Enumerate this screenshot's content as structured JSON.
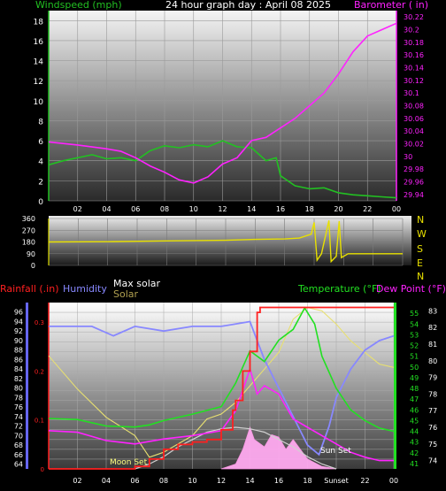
{
  "colors": {
    "wind": "#22c022",
    "baro": "#ff22ff",
    "dir": "#e8e000",
    "rain": "#ff2020",
    "humidity": "#8888ff",
    "maxsolar": "#d0d0d0",
    "solar": "#e8e070",
    "temp": "#22e022",
    "dew": "#ff22ff",
    "solarfill": "#ffaaf0"
  },
  "header": {
    "wind_label": "Windspeed (mph)",
    "title": "24 hour graph day : April 08 2025",
    "baro_label": "Barometer ( in)"
  },
  "mid": {
    "compass": [
      "N",
      "W",
      "S",
      "E",
      "N"
    ]
  },
  "lower": {
    "rain_label": "Rainfall (.in)",
    "humidity_label": "Humidity",
    "maxsolar_label": "Max solar",
    "solar_label": "Solar",
    "temp_label": "Temperature (°F)",
    "dew_label": "Dew Point (°F)",
    "moonset_label": "Moon Set",
    "sunset_label": "Sun Set",
    "sunset_tick_label": "Sunset"
  },
  "chart_data": [
    {
      "type": "line",
      "title": "24 hour graph day : April 08 2025",
      "x_ticks": [
        "02",
        "04",
        "06",
        "08",
        "10",
        "12",
        "14",
        "16",
        "18",
        "20",
        "22",
        "00"
      ],
      "x_range_hours": [
        0,
        24
      ],
      "left_axis": {
        "label": "Windspeed (mph)",
        "ylim": [
          0,
          19
        ],
        "ticks": [
          "0",
          "2",
          "4",
          "6",
          "8",
          "10",
          "12",
          "14",
          "16",
          "18"
        ]
      },
      "right_axis": {
        "label": "Barometer ( in)",
        "ylim": [
          29.93,
          30.23
        ],
        "ticks": [
          "29.94",
          "29.96",
          "29.98",
          "30",
          "30.02",
          "30.04",
          "30.06",
          "30.08",
          "30.1",
          "30.12",
          "30.14",
          "30.16",
          "30.18",
          "30.2",
          "30.22"
        ]
      },
      "series": [
        {
          "name": "Windspeed (mph)",
          "axis": "left",
          "points": [
            [
              0,
              3.6
            ],
            [
              1,
              4.0
            ],
            [
              2,
              4.3
            ],
            [
              3,
              4.6
            ],
            [
              4,
              4.2
            ],
            [
              5,
              4.3
            ],
            [
              6,
              4.0
            ],
            [
              7,
              5.0
            ],
            [
              8,
              5.5
            ],
            [
              9,
              5.3
            ],
            [
              10,
              5.6
            ],
            [
              11,
              5.4
            ],
            [
              12,
              6.0
            ],
            [
              13,
              5.4
            ],
            [
              14,
              5.3
            ],
            [
              15,
              4.0
            ],
            [
              15.7,
              4.3
            ],
            [
              16,
              2.5
            ],
            [
              17,
              1.5
            ],
            [
              18,
              1.2
            ],
            [
              19,
              1.3
            ],
            [
              20,
              0.8
            ],
            [
              21,
              0.6
            ],
            [
              22,
              0.5
            ],
            [
              23,
              0.4
            ],
            [
              24,
              0.3
            ]
          ]
        },
        {
          "name": "Barometer ( in)",
          "axis": "right",
          "points": [
            [
              0,
              30.023
            ],
            [
              2,
              30.018
            ],
            [
              4,
              30.012
            ],
            [
              5,
              30.008
            ],
            [
              6,
              29.998
            ],
            [
              7,
              29.985
            ],
            [
              8,
              29.975
            ],
            [
              9,
              29.963
            ],
            [
              10,
              29.958
            ],
            [
              11,
              29.968
            ],
            [
              12,
              29.988
            ],
            [
              13,
              29.998
            ],
            [
              14,
              30.025
            ],
            [
              15,
              30.03
            ],
            [
              16,
              30.045
            ],
            [
              17,
              30.06
            ],
            [
              18,
              30.08
            ],
            [
              19,
              30.1
            ],
            [
              20,
              30.13
            ],
            [
              21,
              30.165
            ],
            [
              22,
              30.19
            ],
            [
              23,
              30.2
            ],
            [
              24,
              30.21
            ]
          ]
        }
      ]
    },
    {
      "type": "line",
      "title": "",
      "x_ticks": [
        "02",
        "04",
        "06",
        "08",
        "10",
        "12",
        "14",
        "16",
        "18",
        "20",
        "22",
        "00"
      ],
      "x_range_hours": [
        0,
        24
      ],
      "ylim": [
        0,
        360
      ],
      "y_ticks": [
        "0",
        "90",
        "180",
        "270",
        "360"
      ],
      "right_labels": [
        "N",
        "W",
        "S",
        "E",
        "N"
      ],
      "series": [
        {
          "name": "Wind direction",
          "points": [
            [
              0,
              180
            ],
            [
              4,
              182
            ],
            [
              8,
              188
            ],
            [
              12,
              193
            ],
            [
              14,
              200
            ],
            [
              16,
              203
            ],
            [
              17,
              210
            ],
            [
              17.8,
              240
            ],
            [
              18,
              330
            ],
            [
              18.2,
              40
            ],
            [
              18.5,
              90
            ],
            [
              19,
              345
            ],
            [
              19.15,
              30
            ],
            [
              19.5,
              70
            ],
            [
              19.7,
              340
            ],
            [
              19.85,
              60
            ],
            [
              20.3,
              90
            ],
            [
              21,
              90
            ],
            [
              24,
              90
            ]
          ]
        }
      ]
    },
    {
      "type": "line",
      "title": "",
      "x_ticks": [
        "02",
        "04",
        "06",
        "08",
        "10",
        "12",
        "14",
        "16",
        "18",
        "Sunset",
        "22",
        "00"
      ],
      "x_range_hours": [
        0,
        24
      ],
      "axes": {
        "rain": {
          "label": "Rainfall (.in)",
          "ylim": [
            0,
            0.34
          ],
          "ticks": [
            "0",
            "0.1",
            "0.2",
            "0.3"
          ]
        },
        "humidity": {
          "label": "Humidity",
          "ylim": [
            63,
            98
          ],
          "ticks": [
            "64",
            "66",
            "68",
            "70",
            "72",
            "74",
            "76",
            "78",
            "80",
            "82",
            "84",
            "86",
            "88",
            "90",
            "92",
            "94",
            "96"
          ]
        },
        "temperature": {
          "label": "Temperature (°F)",
          "ylim": [
            40.5,
            56
          ],
          "ticks": [
            "41",
            "42",
            "43",
            "44",
            "45",
            "46",
            "47",
            "48",
            "49",
            "50",
            "51",
            "52",
            "53",
            "54",
            "55"
          ]
        },
        "dewpoint": {
          "label": "Dew Point (°F)",
          "ylim": [
            73.5,
            83.5
          ],
          "ticks": [
            "74",
            "75",
            "76",
            "77",
            "78",
            "79",
            "80",
            "81",
            "82",
            "83"
          ]
        }
      },
      "series": [
        {
          "name": "Rainfall (.in)",
          "axis": "rain",
          "points": [
            [
              0,
              0
            ],
            [
              5,
              0
            ],
            [
              6,
              0.005
            ],
            [
              7,
              0.02
            ],
            [
              8,
              0.04
            ],
            [
              9,
              0.05
            ],
            [
              10,
              0.055
            ],
            [
              11,
              0.06
            ],
            [
              12,
              0.08
            ],
            [
              12.8,
              0.12
            ],
            [
              13,
              0.14
            ],
            [
              13.5,
              0.2
            ],
            [
              14,
              0.24
            ],
            [
              14.5,
              0.32
            ],
            [
              14.7,
              0.33
            ],
            [
              15,
              0.33
            ],
            [
              24,
              0.33
            ]
          ]
        },
        {
          "name": "Humidity",
          "axis": "humidity",
          "points": [
            [
              0,
              93
            ],
            [
              3,
              93
            ],
            [
              4.5,
              91
            ],
            [
              6,
              93
            ],
            [
              8,
              92
            ],
            [
              10,
              93
            ],
            [
              12,
              93
            ],
            [
              14,
              94
            ],
            [
              14.5,
              90
            ],
            [
              15,
              86
            ],
            [
              16,
              80
            ],
            [
              17,
              74
            ],
            [
              18,
              68
            ],
            [
              18.8,
              66
            ],
            [
              19.5,
              72
            ],
            [
              20,
              78
            ],
            [
              21,
              84
            ],
            [
              22,
              88
            ],
            [
              23,
              90
            ],
            [
              24,
              91
            ]
          ]
        },
        {
          "name": "Max solar",
          "axis": "rain",
          "points": [
            [
              6,
              0
            ],
            [
              7,
              0.01
            ],
            [
              8,
              0.025
            ],
            [
              9,
              0.045
            ],
            [
              10,
              0.06
            ],
            [
              11,
              0.075
            ],
            [
              12,
              0.082
            ],
            [
              13,
              0.085
            ],
            [
              14,
              0.082
            ],
            [
              15,
              0.075
            ],
            [
              16,
              0.06
            ],
            [
              17,
              0.045
            ],
            [
              18,
              0.025
            ],
            [
              19,
              0.01
            ],
            [
              20,
              0
            ]
          ]
        },
        {
          "name": "Solar",
          "axis": "rain",
          "points": [
            [
              12,
              0
            ],
            [
              13,
              0.01
            ],
            [
              13.5,
              0.04
            ],
            [
              14,
              0.085
            ],
            [
              14.3,
              0.06
            ],
            [
              15,
              0.045
            ],
            [
              15.5,
              0.07
            ],
            [
              16,
              0.065
            ],
            [
              16.5,
              0.04
            ],
            [
              17,
              0.06
            ],
            [
              18,
              0.02
            ],
            [
              19,
              0.005
            ],
            [
              20,
              0
            ]
          ]
        },
        {
          "name": "Temperature (°F)",
          "axis": "temperature",
          "points": [
            [
              0,
              45.2
            ],
            [
              2,
              45.1
            ],
            [
              4,
              44.5
            ],
            [
              6,
              44.4
            ],
            [
              7,
              44.6
            ],
            [
              8,
              45.0
            ],
            [
              10,
              45.6
            ],
            [
              12,
              46.3
            ],
            [
              13,
              48.5
            ],
            [
              14,
              51.5
            ],
            [
              15,
              50.5
            ],
            [
              16,
              52.5
            ],
            [
              17,
              53.5
            ],
            [
              17.8,
              55.5
            ],
            [
              18.5,
              54
            ],
            [
              19,
              51
            ],
            [
              20,
              48
            ],
            [
              21,
              46
            ],
            [
              22,
              45
            ],
            [
              23,
              44.3
            ],
            [
              24,
              44.0
            ]
          ]
        },
        {
          "name": "Dew Point (°F)",
          "axis": "dewpoint",
          "points": [
            [
              0,
              75.8
            ],
            [
              2,
              75.7
            ],
            [
              4,
              75.2
            ],
            [
              6,
              75.0
            ],
            [
              8,
              75.3
            ],
            [
              10,
              75.5
            ],
            [
              12,
              75.8
            ],
            [
              13,
              77.0
            ],
            [
              14,
              79.5
            ],
            [
              14.5,
              78
            ],
            [
              15,
              78.5
            ],
            [
              16,
              78.0
            ],
            [
              17,
              76.5
            ],
            [
              18,
              76.0
            ],
            [
              19,
              75.5
            ],
            [
              20,
              75.0
            ],
            [
              21,
              74.5
            ],
            [
              22,
              74.2
            ],
            [
              23,
              74.0
            ],
            [
              24,
              74.0
            ]
          ]
        },
        {
          "name": "Solar (right)",
          "axis": "dewpoint",
          "points": [
            [
              0,
              80.3
            ],
            [
              2,
              78.3
            ],
            [
              4,
              76.6
            ],
            [
              6,
              75.5
            ],
            [
              7,
              74.2
            ],
            [
              8,
              74.5
            ],
            [
              10,
              75.5
            ],
            [
              11,
              76.5
            ],
            [
              12,
              76.8
            ],
            [
              13,
              77.5
            ],
            [
              14,
              78.5
            ],
            [
              15,
              79.5
            ],
            [
              16,
              80.5
            ],
            [
              17,
              82.5
            ],
            [
              18,
              83.2
            ],
            [
              19,
              83.0
            ],
            [
              20,
              82.2
            ],
            [
              21,
              81.2
            ],
            [
              22,
              80.5
            ],
            [
              23,
              79.8
            ],
            [
              24,
              79.6
            ]
          ]
        }
      ]
    }
  ]
}
